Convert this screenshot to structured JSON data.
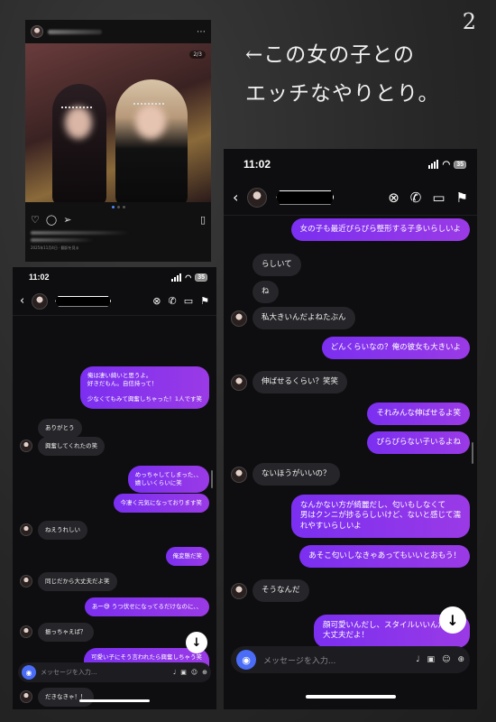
{
  "page_number": "2",
  "caption_lines": [
    "←この女の子との",
    "エッチなやりとり。"
  ],
  "post": {
    "page_indicator": "2/3",
    "date_text": "2025年11月4日 · 翻訳を見る"
  },
  "left_phone": {
    "time": "11:02",
    "battery": "35",
    "messages": [
      {
        "dir": "out",
        "text": "俺は凄い綺いと思うよ。\n好きだもん。自信持って！\n\n少なくてもみて興奮しちゃった！1人です笑"
      },
      {
        "dir": "in",
        "text": "ありがとう",
        "avatar": false
      },
      {
        "dir": "in",
        "text": "興奮してくれたの笑",
        "avatar": true
      },
      {
        "dir": "out",
        "text": "めっちゃしてしまった、、\n嬉しいくらいに笑"
      },
      {
        "dir": "out",
        "text": "今凄く元気になっております笑"
      },
      {
        "dir": "in",
        "text": "ねえうれしい",
        "avatar": true
      },
      {
        "dir": "out",
        "text": "俺変態だ笑"
      },
      {
        "dir": "in",
        "text": "同じだから大丈夫だよ笑",
        "avatar": true
      },
      {
        "dir": "out",
        "text": "あー😅 うつ伏せになってるだけなのに、、"
      },
      {
        "dir": "in",
        "text": "振っちゃえば？",
        "avatar": true
      },
      {
        "dir": "out",
        "text": "可愛い子にそう言われたら興奮しちゃう笑\n\n最近溜まり過ぎてて、、😅"
      },
      {
        "dir": "in",
        "text": "だきなきゃ！！",
        "avatar": true
      }
    ],
    "composer_placeholder": "メッセージを入力..."
  },
  "right_phone": {
    "time": "11:02",
    "battery": "35",
    "messages": [
      {
        "dir": "out",
        "text": "女の子も最近ぴらぴら整形する子多いらしいよ"
      },
      {
        "dir": "in",
        "text": "らしいて",
        "avatar": false
      },
      {
        "dir": "in",
        "text": "ね",
        "avatar": false
      },
      {
        "dir": "in",
        "text": "私大きいんだよねたぶん",
        "avatar": true
      },
      {
        "dir": "out",
        "text": "どんくらいなの？俺の彼女も大きいよ"
      },
      {
        "dir": "in",
        "text": "伸ばせるくらい？笑笑",
        "avatar": true
      },
      {
        "dir": "out",
        "text": "それみんな伸ばせるよ笑"
      },
      {
        "dir": "out",
        "text": "ぴらぴらない子いるよね"
      },
      {
        "dir": "in",
        "text": "ないほうがいいの？",
        "avatar": true
      },
      {
        "dir": "out",
        "text": "なんかない方が綺麗だし、匂いもしなくて\n男はクンニが捗るらしいけど、ないと感じて濡\nれやすいらしいよ"
      },
      {
        "dir": "out",
        "text": "あそこ匂いしなきゃあってもいいとおもう！"
      },
      {
        "dir": "in",
        "text": "そうなんだ",
        "avatar": true
      },
      {
        "dir": "out",
        "text": "顔可愛いんだし、スタイルいいんだから\n大丈夫だよ！"
      }
    ],
    "composer_placeholder": "メッセージを入力..."
  }
}
